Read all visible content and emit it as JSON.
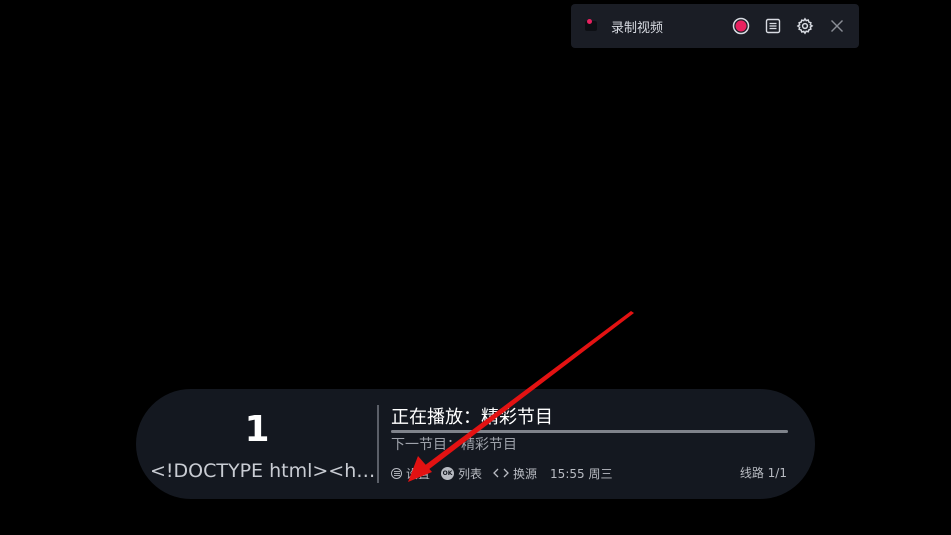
{
  "recorder": {
    "title": "录制视频",
    "icons": {
      "app": "camera-record-icon",
      "record": "record-icon",
      "list": "list-icon",
      "settings": "gear-icon",
      "close": "close-icon"
    }
  },
  "channel": {
    "number": "1",
    "name": "<!DOCTYPE html><html><head><title>"
  },
  "program": {
    "now_playing": "正在播放：精彩节目",
    "next": "下一节目：精彩节目",
    "progress": 1.0
  },
  "hints": {
    "settings": "设置",
    "list": "列表",
    "switch_source": "换源",
    "time": "15:55 周三"
  },
  "line_info": "线路 1/1",
  "colors": {
    "accent_record": "#e8215f",
    "annotation": "#e31212",
    "toolbar_bg": "#1a1d25",
    "bar_bg": "#141820"
  }
}
